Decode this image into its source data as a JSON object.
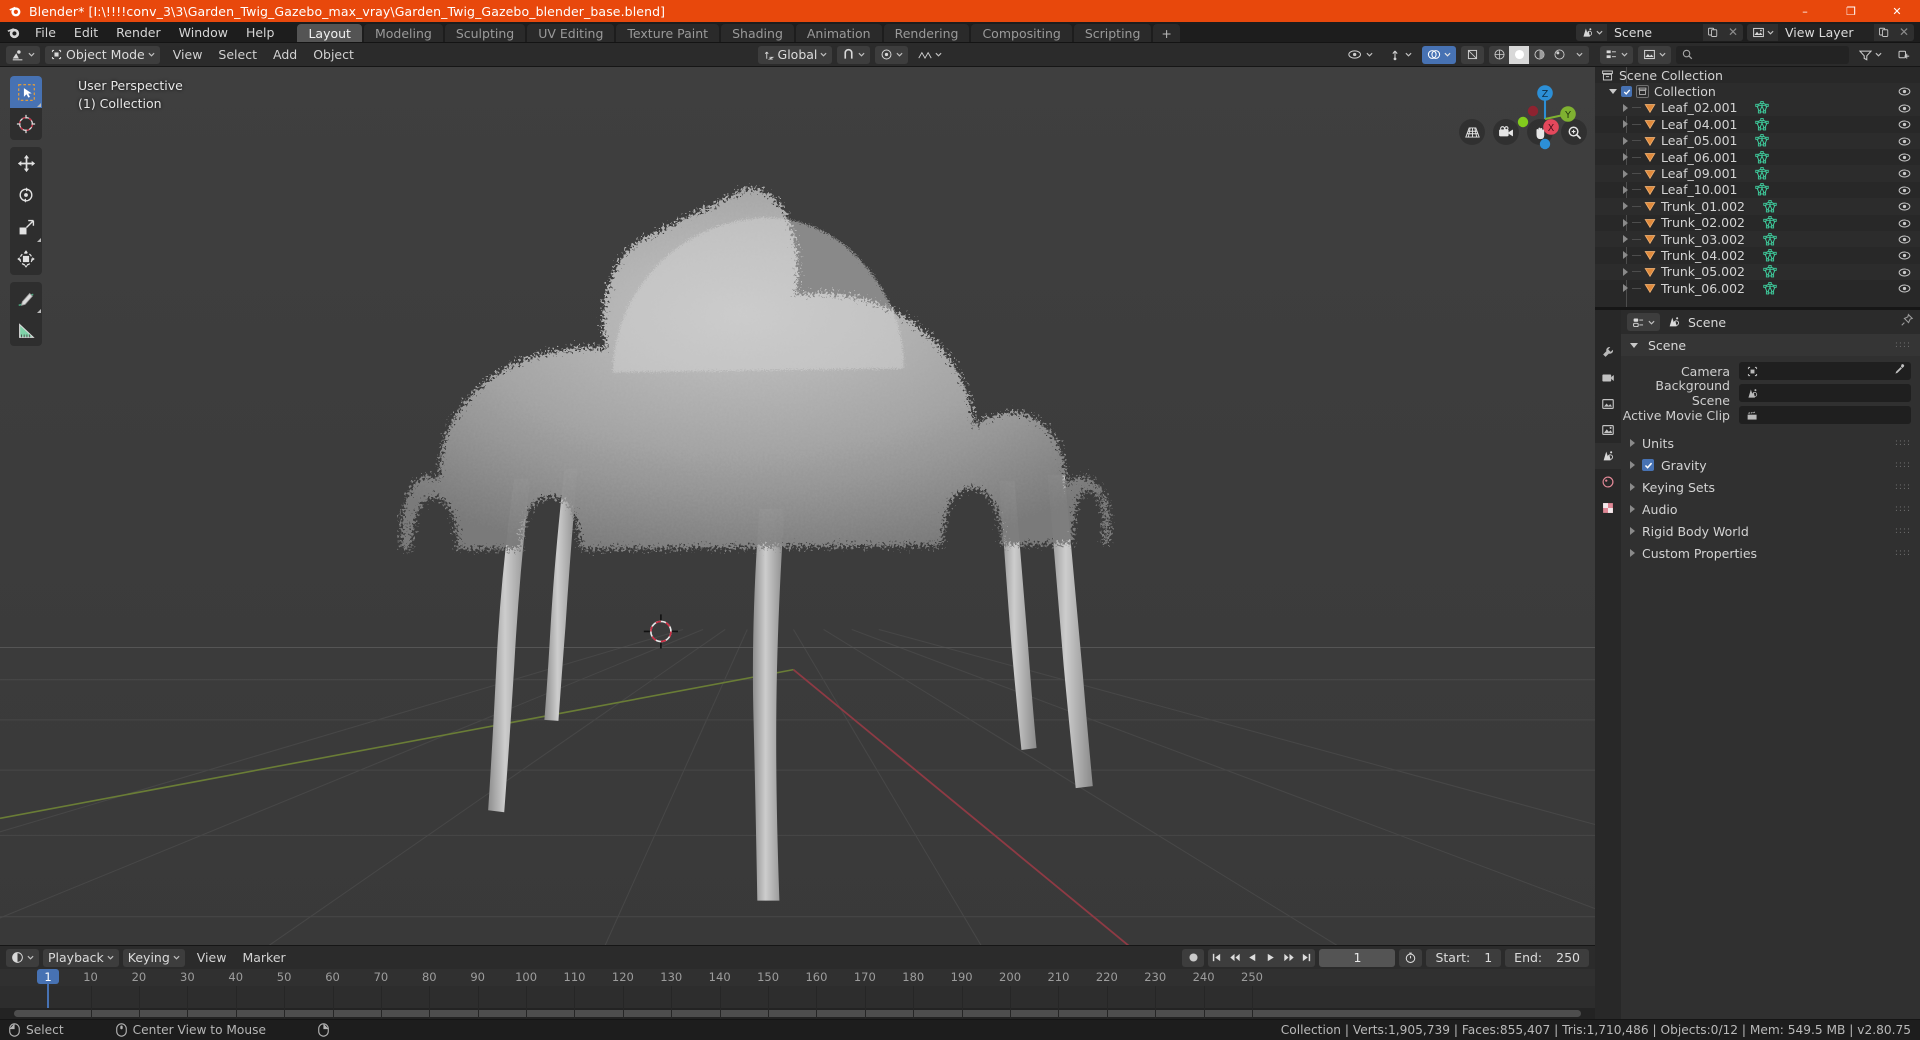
{
  "window": {
    "title": "Blender* [I:\\!!!!conv_3\\3\\Garden_Twig_Gazebo_max_vray\\Garden_Twig_Gazebo_blender_base.blend]",
    "minimize": "–",
    "maximize": "❐",
    "close": "✕"
  },
  "topbar": {
    "menus": [
      "File",
      "Edit",
      "Render",
      "Window",
      "Help"
    ],
    "workspaces": [
      {
        "label": "Layout",
        "active": true
      },
      {
        "label": "Modeling",
        "active": false
      },
      {
        "label": "Sculpting",
        "active": false
      },
      {
        "label": "UV Editing",
        "active": false
      },
      {
        "label": "Texture Paint",
        "active": false
      },
      {
        "label": "Shading",
        "active": false
      },
      {
        "label": "Animation",
        "active": false
      },
      {
        "label": "Rendering",
        "active": false
      },
      {
        "label": "Compositing",
        "active": false
      },
      {
        "label": "Scripting",
        "active": false
      }
    ],
    "add_workspace": "+",
    "scene_name": "Scene",
    "view_layer_name": "View Layer"
  },
  "viewport_header": {
    "mode": "Object Mode",
    "menus": [
      "View",
      "Select",
      "Add",
      "Object"
    ],
    "transform_orientation": "Global"
  },
  "viewport": {
    "perspective_label": "User Perspective",
    "collection_label": "(1) Collection",
    "gizmo_axes": [
      "X",
      "Y",
      "Z"
    ],
    "accent_color": "#4772b3",
    "background_color": "#3b3b3b",
    "tools": [
      "select-box-tool",
      "cursor-tool",
      "move-tool",
      "rotate-tool",
      "scale-tool",
      "transform-tool",
      "annotate-tool",
      "measure-tool"
    ],
    "nav_buttons": [
      "grid-perspective-icon",
      "camera-icon",
      "hand-pan-icon",
      "zoom-icon"
    ]
  },
  "outliner": {
    "root": "Scene Collection",
    "collection": "Collection",
    "items": [
      {
        "name": "Leaf_02.001",
        "type": "mesh"
      },
      {
        "name": "Leaf_04.001",
        "type": "mesh"
      },
      {
        "name": "Leaf_05.001",
        "type": "mesh"
      },
      {
        "name": "Leaf_06.001",
        "type": "mesh"
      },
      {
        "name": "Leaf_09.001",
        "type": "mesh"
      },
      {
        "name": "Leaf_10.001",
        "type": "mesh"
      },
      {
        "name": "Trunk_01.002",
        "type": "mesh"
      },
      {
        "name": "Trunk_02.002",
        "type": "mesh"
      },
      {
        "name": "Trunk_03.002",
        "type": "mesh"
      },
      {
        "name": "Trunk_04.002",
        "type": "mesh"
      },
      {
        "name": "Trunk_05.002",
        "type": "mesh"
      },
      {
        "name": "Trunk_06.002",
        "type": "mesh"
      }
    ],
    "search_placeholder": ""
  },
  "properties": {
    "breadcrumb": "Scene",
    "panel_title": "Scene",
    "fields": [
      {
        "label": "Camera",
        "value": "",
        "icon": "camera-data-icon"
      },
      {
        "label": "Background Scene",
        "value": "",
        "icon": "scene-icon"
      },
      {
        "label": "Active Movie Clip",
        "value": "",
        "icon": "clip-icon"
      }
    ],
    "sections": [
      {
        "label": "Units",
        "checkbox": false
      },
      {
        "label": "Gravity",
        "checkbox": true
      },
      {
        "label": "Keying Sets",
        "checkbox": false
      },
      {
        "label": "Audio",
        "checkbox": false
      },
      {
        "label": "Rigid Body World",
        "checkbox": false
      },
      {
        "label": "Custom Properties",
        "checkbox": false
      }
    ],
    "tabs": [
      "tool-tab",
      "render-tab",
      "output-tab",
      "view-layer-tab",
      "scene-tab",
      "world-tab",
      "texture-tab"
    ]
  },
  "timeline": {
    "menus": [
      "Playback",
      "Keying",
      "View",
      "Marker"
    ],
    "current_frame": "1",
    "start_label": "Start:",
    "start_value": "1",
    "end_label": "End:",
    "end_value": "250",
    "ticks": [
      10,
      20,
      30,
      40,
      50,
      60,
      70,
      80,
      90,
      100,
      110,
      120,
      130,
      140,
      150,
      160,
      170,
      180,
      190,
      200,
      210,
      220,
      230,
      240,
      250
    ],
    "playhead_frame": "1"
  },
  "statusbar": {
    "mouse_left_label": "Select",
    "mouse_middle_label": "Center View to Mouse",
    "stats": "Collection | Verts:1,905,739 | Faces:855,407 | Tris:1,710,486 | Objects:0/12 | Mem: 549.5 MB | v2.80.75"
  }
}
